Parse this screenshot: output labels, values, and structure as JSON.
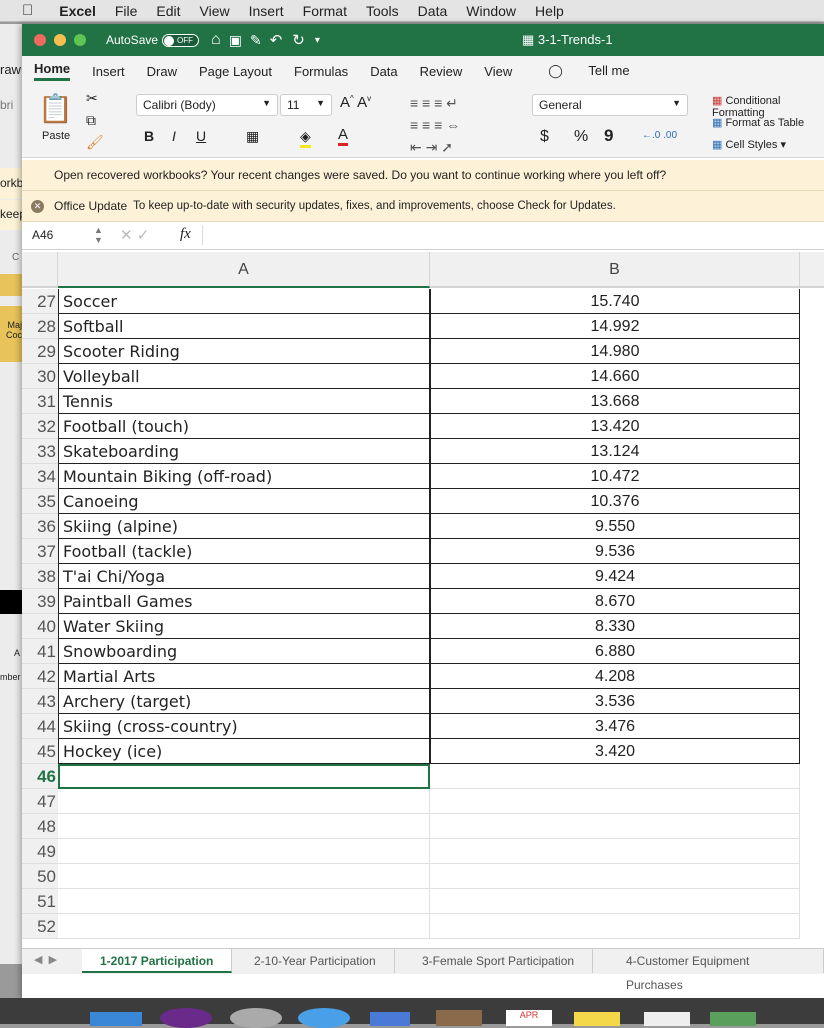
{
  "menubar": {
    "app": "Excel",
    "items": [
      "File",
      "Edit",
      "View",
      "Insert",
      "Format",
      "Tools",
      "Data",
      "Window",
      "Help"
    ]
  },
  "titlebar": {
    "autosave": "AutoSave",
    "toggle": "OFF",
    "doc_title": "3-1-Trends-1"
  },
  "ribbon_tabs": [
    "Home",
    "Insert",
    "Draw",
    "Page Layout",
    "Formulas",
    "Data",
    "Review",
    "View"
  ],
  "tell_me": "Tell me",
  "ribbon": {
    "paste": "Paste",
    "font": "Calibri (Body)",
    "size": "11",
    "number_format": "General",
    "conditional": "Conditional Formatting",
    "format_table": "Format as Table",
    "cell_styles": "Cell Styles",
    "bold": "B",
    "italic": "I",
    "underline": "U",
    "currency": "$",
    "percent": "%",
    "comma": "9"
  },
  "notices": {
    "recovered": "Open recovered workbooks?  Your recent changes were saved. Do you want to continue working where you left off?",
    "update_title": "Office Update",
    "update_text": "To keep up-to-date with security updates, fixes, and improvements, choose Check for Updates."
  },
  "formula_bar": {
    "name_box": "A46",
    "fx": "fx",
    "value": ""
  },
  "bg_window": {
    "tab": "raw",
    "font": "bri",
    "text1": "orkb",
    "text2": "keep",
    "col": "C",
    "header1": "Maj",
    "header2": "Coc",
    "a": "A",
    "number": "mber"
  },
  "columns": [
    "A",
    "B"
  ],
  "rows": [
    {
      "n": "27",
      "a": "Soccer",
      "b": "15.740"
    },
    {
      "n": "28",
      "a": "Softball",
      "b": "14.992"
    },
    {
      "n": "29",
      "a": "Scooter Riding",
      "b": "14.980"
    },
    {
      "n": "30",
      "a": "Volleyball",
      "b": "14.660"
    },
    {
      "n": "31",
      "a": "Tennis",
      "b": "13.668"
    },
    {
      "n": "32",
      "a": "Football (touch)",
      "b": "13.420"
    },
    {
      "n": "33",
      "a": "Skateboarding",
      "b": "13.124"
    },
    {
      "n": "34",
      "a": "Mountain Biking (off-road)",
      "b": "10.472"
    },
    {
      "n": "35",
      "a": "Canoeing",
      "b": "10.376"
    },
    {
      "n": "36",
      "a": "Skiing (alpine)",
      "b": "9.550"
    },
    {
      "n": "37",
      "a": "Football (tackle)",
      "b": "9.536"
    },
    {
      "n": "38",
      "a": "T'ai Chi/Yoga",
      "b": "9.424"
    },
    {
      "n": "39",
      "a": "Paintball Games",
      "b": "8.670"
    },
    {
      "n": "40",
      "a": "Water Skiing",
      "b": "8.330"
    },
    {
      "n": "41",
      "a": "Snowboarding",
      "b": "6.880"
    },
    {
      "n": "42",
      "a": "Martial Arts",
      "b": "4.208"
    },
    {
      "n": "43",
      "a": "Archery (target)",
      "b": "3.536"
    },
    {
      "n": "44",
      "a": "Skiing (cross-country)",
      "b": "3.476"
    },
    {
      "n": "45",
      "a": "Hockey (ice)",
      "b": "3.420"
    },
    {
      "n": "46",
      "a": "",
      "b": ""
    },
    {
      "n": "47",
      "a": "",
      "b": ""
    },
    {
      "n": "48",
      "a": "",
      "b": ""
    },
    {
      "n": "49",
      "a": "",
      "b": ""
    },
    {
      "n": "50",
      "a": "",
      "b": ""
    },
    {
      "n": "51",
      "a": "",
      "b": ""
    },
    {
      "n": "52",
      "a": "",
      "b": ""
    }
  ],
  "selected_cell": "A46",
  "sheet_tabs": [
    "1-2017 Participation",
    "2-10-Year Participation",
    "3-Female Sport Participation",
    "4-Customer Equipment Purchases"
  ],
  "active_sheet": "1-2017 Participation",
  "dock_label": "APR",
  "colors": {
    "title_green": "#217346",
    "notice_bg": "#fdf2d7",
    "active_tab": "#217346"
  }
}
